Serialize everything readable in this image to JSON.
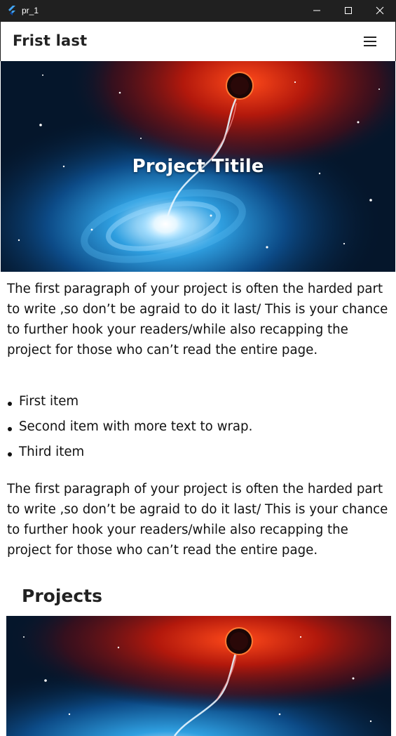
{
  "window": {
    "title": "pr_1",
    "icons": [
      "flutter-icon",
      "minimize-icon",
      "maximize-icon",
      "close-icon"
    ]
  },
  "appbar": {
    "title": "Frist last",
    "menu_icon": "hamburger-menu-icon"
  },
  "hero": {
    "title": "Project Titile",
    "image": "galaxy-with-black-hole-image"
  },
  "content": {
    "paragraph1": "The first paragraph of your project is often the harded part to write ,so don’t be agraid to do it last/ This is your chance to further hook your readers/while also recapping the project for those who can’t read the entire page.",
    "bullets": [
      "First item",
      "Second item with more text to wrap.",
      "Third item"
    ],
    "paragraph2": "The first paragraph of your project is often the harded part to write ,so don’t be agraid to do it last/ This is your chance to further hook your readers/while also recapping the project for those who can’t read the entire page.",
    "section_title": "Projects",
    "project_image": "galaxy-with-black-hole-image"
  },
  "colors": {
    "titlebar": "#202020",
    "text": "#111111",
    "space_dark": "#04182f",
    "nebula_red": "#c0200c",
    "galaxy_blue": "#2f9fe0"
  }
}
